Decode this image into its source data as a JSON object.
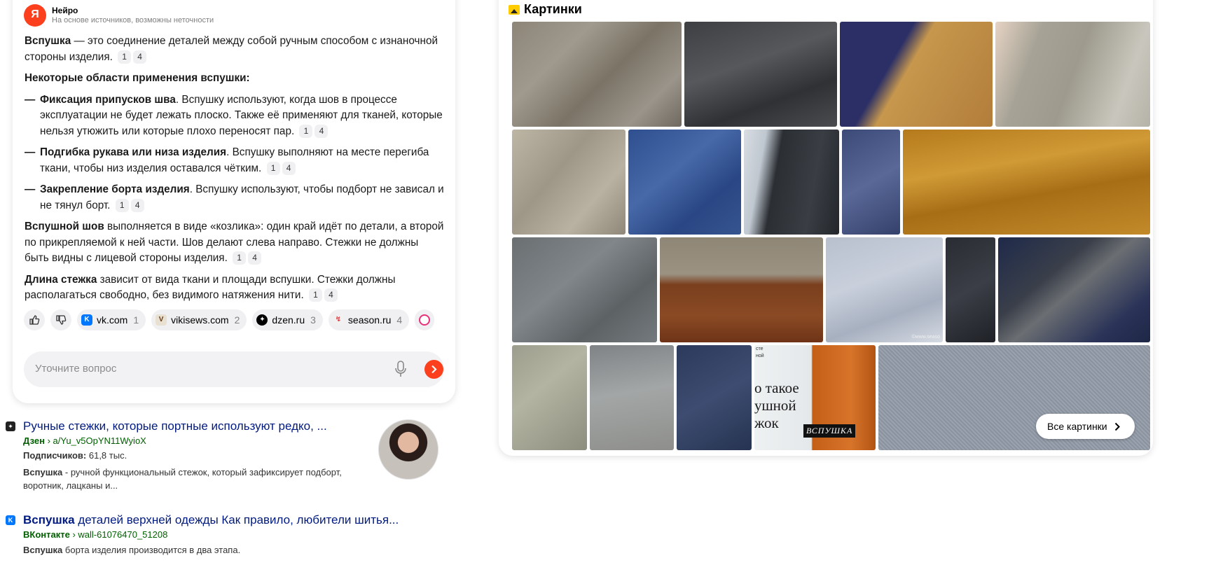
{
  "neuro": {
    "title": "Нейро",
    "subtitle": "На основе источников, возможны неточности",
    "logo_letter": "Я",
    "p1_bold": "Вспушка",
    "p1_text": " — это соединение деталей между собой ручным способом с изнаночной стороны изделия.",
    "p1_cites": [
      "1",
      "4"
    ],
    "heading": "Некоторые области применения вспушки:",
    "items": [
      {
        "bold": "Фиксация припусков шва",
        "text": ". Вспушку используют, когда шов в процессе эксплуатации не будет лежать плоско. Также её применяют для тканей, которые нельзя утюжить или которые плохо переносят пар.",
        "cites": [
          "1",
          "4"
        ]
      },
      {
        "bold": "Подгибка рукава или низа изделия",
        "text": ". Вспушку выполняют на месте перегиба ткани, чтобы низ изделия оставался чётким.",
        "cites": [
          "1",
          "4"
        ]
      },
      {
        "bold": "Закрепление борта изделия",
        "text": ". Вспушку используют, чтобы подборт не зависал и не тянул борт.",
        "cites": [
          "1",
          "4"
        ]
      }
    ],
    "p2_bold": "Вспушной шов",
    "p2_text": " выполняется в виде «козлика»: один край идёт по детали, а второй по прикрепляемой к ней части. Шов делают слева направо. Стежки не должны быть видны с лицевой стороны изделия.",
    "p2_cites": [
      "1",
      "4"
    ],
    "p3_bold": "Длина стежка",
    "p3_text": " зависит от вида ткани и площади вспушки. Стежки должны располагаться свободно, без видимого натяжения нити.",
    "p3_cites": [
      "1",
      "4"
    ],
    "sources": [
      {
        "name": "vk.com",
        "count": "1",
        "icon": "vk-icon",
        "color": "#0077ff",
        "glyph": "K"
      },
      {
        "name": "vikisews.com",
        "count": "2",
        "icon": "vikisews-icon",
        "color": "#e8e0d0",
        "glyph": "V"
      },
      {
        "name": "dzen.ru",
        "count": "3",
        "icon": "dzen-icon",
        "color": "#000000",
        "glyph": "✦"
      },
      {
        "name": "season.ru",
        "count": "4",
        "icon": "season-icon",
        "color": "#f1f1f1",
        "glyph": "↯"
      }
    ],
    "ask_placeholder": "Уточните вопрос"
  },
  "results": [
    {
      "icon": "dzen-icon",
      "title": "Ручные стежки, которые портные используют редко, ...",
      "crumb_site": "Дзен",
      "crumb_path": " › a/Yu_v5OpYN11WyioX",
      "meta_label": "Подписчиков:",
      "meta_value": " 61,8 тыс.",
      "snippet_bold": "Вспушка",
      "snippet_text": " - ручной функциональный стежок, который зафиксирует подборт, воротник, лацканы и..."
    },
    {
      "icon": "vk-icon",
      "title_bold": "Вспушка",
      "title_text": " деталей верхней одежды Как правило, любители шитья...",
      "crumb_site": "ВКонтакте",
      "crumb_path": " › wall-61076470_51208",
      "snippet_bold": "Вспушка",
      "snippet_text": " борта изделия производится в два этапа."
    }
  ],
  "images": {
    "title": "Картинки",
    "all_button": "Все картинки",
    "tile_caption_lines": [
      "о такое",
      "ушной",
      "жок"
    ],
    "tile_small_lines": [
      "сте",
      "ной"
    ],
    "tile_badge": "ВСПУШКА",
    "tile_watermark": "©www.seaso"
  }
}
